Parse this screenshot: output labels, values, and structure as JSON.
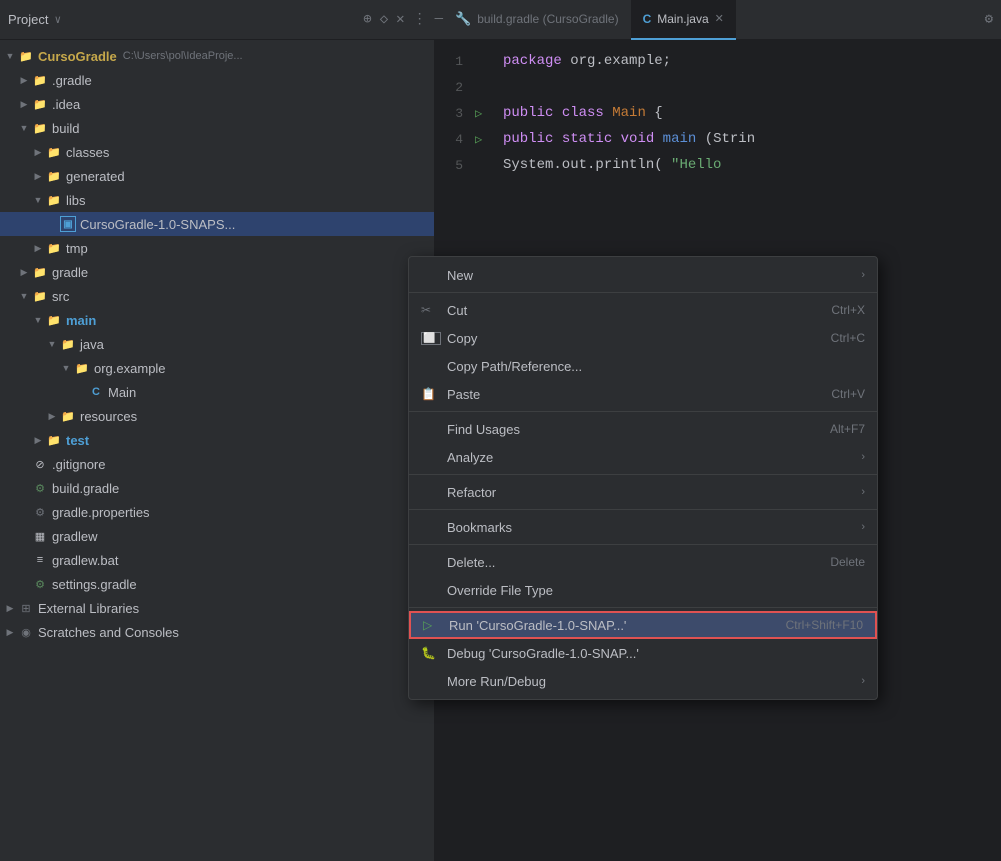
{
  "titleBar": {
    "projectLabel": "Project",
    "chevron": "∨",
    "icons": [
      "⊕",
      "◇",
      "✕",
      "⋮",
      "—"
    ]
  },
  "tabs": [
    {
      "id": "gradle",
      "label": "build.gradle (CursoGradle)",
      "icon": "🔧",
      "active": false
    },
    {
      "id": "java",
      "label": "Main.java",
      "icon": "C",
      "active": true
    }
  ],
  "sidebar": {
    "items": [
      {
        "id": "cursoGradle",
        "indent": 0,
        "chevron": "▼",
        "icon": "folder",
        "label": "CursoGradle",
        "extra": "C:\\Users\\pol\\IdeaProje...",
        "selected": false
      },
      {
        "id": "gradle",
        "indent": 1,
        "chevron": "▶",
        "icon": "folder",
        "label": ".gradle",
        "selected": false
      },
      {
        "id": "idea",
        "indent": 1,
        "chevron": "▶",
        "icon": "folder",
        "label": ".idea",
        "selected": false
      },
      {
        "id": "build",
        "indent": 1,
        "chevron": "▼",
        "icon": "folder-orange",
        "label": "build",
        "selected": false
      },
      {
        "id": "classes",
        "indent": 2,
        "chevron": "▶",
        "icon": "folder",
        "label": "classes",
        "selected": false
      },
      {
        "id": "generated",
        "indent": 2,
        "chevron": "▶",
        "icon": "folder",
        "label": "generated",
        "selected": false
      },
      {
        "id": "libs",
        "indent": 2,
        "chevron": "▼",
        "icon": "folder",
        "label": "libs",
        "selected": false
      },
      {
        "id": "jarFile",
        "indent": 3,
        "chevron": "",
        "icon": "jar",
        "label": "CursoGradle-1.0-SNAPS...",
        "selected": true
      },
      {
        "id": "tmp",
        "indent": 2,
        "chevron": "▶",
        "icon": "folder",
        "label": "tmp",
        "selected": false
      },
      {
        "id": "gradleDir",
        "indent": 1,
        "chevron": "▶",
        "icon": "folder",
        "label": "gradle",
        "selected": false
      },
      {
        "id": "src",
        "indent": 1,
        "chevron": "▼",
        "icon": "folder-blue",
        "label": "src",
        "selected": false
      },
      {
        "id": "main",
        "indent": 2,
        "chevron": "▼",
        "icon": "folder-blue",
        "label": "main",
        "selected": false
      },
      {
        "id": "java",
        "indent": 3,
        "chevron": "▼",
        "icon": "folder-blue",
        "label": "java",
        "selected": false
      },
      {
        "id": "orgExample",
        "indent": 4,
        "chevron": "▼",
        "icon": "folder-blue",
        "label": "org.example",
        "selected": false
      },
      {
        "id": "main-java",
        "indent": 5,
        "chevron": "",
        "icon": "java",
        "label": "Main",
        "selected": false
      },
      {
        "id": "resources",
        "indent": 3,
        "chevron": "▶",
        "icon": "folder",
        "label": "resources",
        "selected": false
      },
      {
        "id": "test",
        "indent": 2,
        "chevron": "▶",
        "icon": "folder-blue",
        "label": "test",
        "selected": false
      },
      {
        "id": "gitignore",
        "indent": 1,
        "chevron": "",
        "icon": "gitignore",
        "label": ".gitignore",
        "selected": false
      },
      {
        "id": "buildGradle",
        "indent": 1,
        "chevron": "",
        "icon": "gradle",
        "label": "build.gradle",
        "selected": false
      },
      {
        "id": "gradleProps",
        "indent": 1,
        "chevron": "",
        "icon": "gear",
        "label": "gradle.properties",
        "selected": false
      },
      {
        "id": "gradlew",
        "indent": 1,
        "chevron": "",
        "icon": "terminal",
        "label": "gradlew",
        "selected": false
      },
      {
        "id": "gradlewBat",
        "indent": 1,
        "chevron": "",
        "icon": "file",
        "label": "gradlew.bat",
        "selected": false
      },
      {
        "id": "settingsGradle",
        "indent": 1,
        "chevron": "",
        "icon": "gradle",
        "label": "settings.gradle",
        "selected": false
      },
      {
        "id": "extLibs",
        "indent": 0,
        "chevron": "▶",
        "icon": "library",
        "label": "External Libraries",
        "selected": false
      },
      {
        "id": "scratches",
        "indent": 0,
        "chevron": "▶",
        "icon": "scratch",
        "label": "Scratches and Consoles",
        "selected": false
      }
    ]
  },
  "codeLines": [
    {
      "num": "1",
      "content": "package org.example;",
      "run": false
    },
    {
      "num": "2",
      "content": "",
      "run": false
    },
    {
      "num": "3",
      "content": "public class Main {",
      "run": true
    },
    {
      "num": "4",
      "content": "    public static void main(Strin",
      "run": true
    },
    {
      "num": "5",
      "content": "        System.out.println(\"Hello",
      "run": false
    }
  ],
  "contextMenu": {
    "items": [
      {
        "id": "new",
        "icon": "",
        "label": "New",
        "shortcut": "",
        "hasArrow": true,
        "separator": false,
        "highlighted": false,
        "type": "normal"
      },
      {
        "id": "sep1",
        "type": "separator"
      },
      {
        "id": "cut",
        "icon": "✂",
        "label": "Cut",
        "shortcut": "Ctrl+X",
        "hasArrow": false,
        "separator": false,
        "highlighted": false,
        "type": "normal"
      },
      {
        "id": "copy",
        "icon": "⬜",
        "label": "Copy",
        "shortcut": "Ctrl+C",
        "hasArrow": false,
        "separator": false,
        "highlighted": false,
        "type": "normal"
      },
      {
        "id": "copyPath",
        "icon": "",
        "label": "Copy Path/Reference...",
        "shortcut": "",
        "hasArrow": false,
        "separator": false,
        "highlighted": false,
        "type": "normal"
      },
      {
        "id": "paste",
        "icon": "📋",
        "label": "Paste",
        "shortcut": "Ctrl+V",
        "hasArrow": false,
        "separator": false,
        "highlighted": false,
        "type": "normal"
      },
      {
        "id": "sep2",
        "type": "separator"
      },
      {
        "id": "findUsages",
        "icon": "",
        "label": "Find Usages",
        "shortcut": "Alt+F7",
        "hasArrow": false,
        "separator": false,
        "highlighted": false,
        "type": "normal"
      },
      {
        "id": "analyze",
        "icon": "",
        "label": "Analyze",
        "shortcut": "",
        "hasArrow": true,
        "separator": false,
        "highlighted": false,
        "type": "normal"
      },
      {
        "id": "sep3",
        "type": "separator"
      },
      {
        "id": "refactor",
        "icon": "",
        "label": "Refactor",
        "shortcut": "",
        "hasArrow": true,
        "separator": false,
        "highlighted": false,
        "type": "normal"
      },
      {
        "id": "sep4",
        "type": "separator"
      },
      {
        "id": "bookmarks",
        "icon": "",
        "label": "Bookmarks",
        "shortcut": "",
        "hasArrow": true,
        "separator": false,
        "highlighted": false,
        "type": "normal"
      },
      {
        "id": "sep5",
        "type": "separator"
      },
      {
        "id": "delete",
        "icon": "",
        "label": "Delete...",
        "shortcut": "Delete",
        "hasArrow": false,
        "separator": false,
        "highlighted": false,
        "type": "normal"
      },
      {
        "id": "overrideFileType",
        "icon": "",
        "label": "Override File Type",
        "shortcut": "",
        "hasArrow": false,
        "separator": false,
        "highlighted": false,
        "type": "normal"
      },
      {
        "id": "sep6",
        "type": "separator"
      },
      {
        "id": "run",
        "icon": "▷",
        "label": "Run 'CursoGradle-1.0-SNAP...'",
        "shortcut": "Ctrl+Shift+F10",
        "hasArrow": false,
        "separator": false,
        "highlighted": true,
        "type": "run"
      },
      {
        "id": "debug",
        "icon": "🐛",
        "label": "Debug 'CursoGradle-1.0-SNAP...'",
        "shortcut": "",
        "hasArrow": false,
        "separator": false,
        "highlighted": false,
        "type": "debug"
      },
      {
        "id": "moreRunDebug",
        "icon": "",
        "label": "More Run/Debug",
        "shortcut": "",
        "hasArrow": true,
        "separator": false,
        "highlighted": false,
        "type": "normal"
      }
    ]
  }
}
